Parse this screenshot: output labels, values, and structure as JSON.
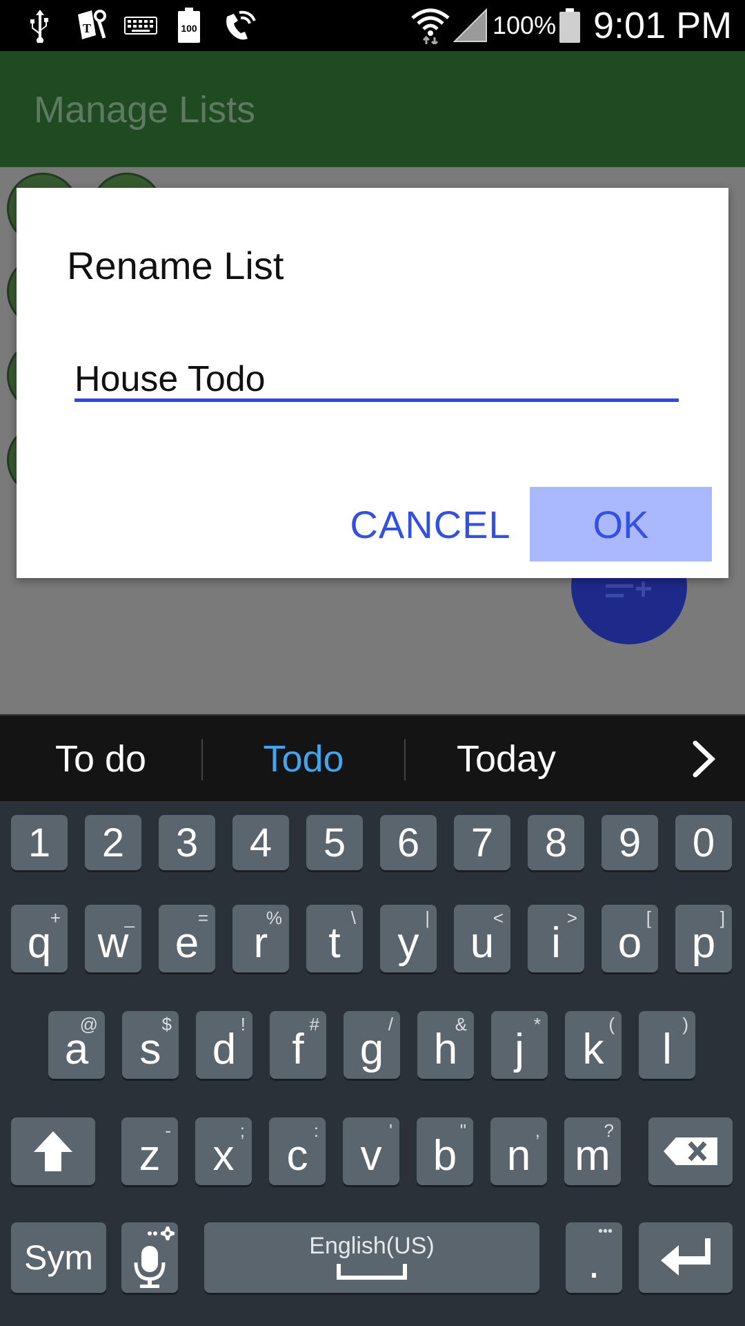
{
  "status_bar": {
    "battery_percent": "100%",
    "time": "9:01 PM",
    "icons": [
      "usb-icon",
      "t-mobile-icon",
      "keyboard-icon",
      "battery-100-icon",
      "wifi-call-icon",
      "wifi-icon",
      "signal-icon",
      "battery-icon"
    ],
    "battery_badge": "100"
  },
  "app": {
    "title": "Manage Lists"
  },
  "dialog": {
    "title": "Rename List",
    "input_value": "House Todo",
    "cancel_label": "CANCEL",
    "ok_label": "OK"
  },
  "keyboard": {
    "suggestions": [
      "To do",
      "Todo",
      "Today"
    ],
    "selected_suggestion": "Todo",
    "row_numbers": [
      "1",
      "2",
      "3",
      "4",
      "5",
      "6",
      "7",
      "8",
      "9",
      "0"
    ],
    "row1": [
      {
        "k": "q",
        "h": "+"
      },
      {
        "k": "w",
        "h": "_"
      },
      {
        "k": "e",
        "h": "="
      },
      {
        "k": "r",
        "h": "%"
      },
      {
        "k": "t",
        "h": "\\"
      },
      {
        "k": "y",
        "h": "|"
      },
      {
        "k": "u",
        "h": "<"
      },
      {
        "k": "i",
        "h": ">"
      },
      {
        "k": "o",
        "h": "["
      },
      {
        "k": "p",
        "h": "]"
      }
    ],
    "row2": [
      {
        "k": "a",
        "h": "@"
      },
      {
        "k": "s",
        "h": "$"
      },
      {
        "k": "d",
        "h": "!"
      },
      {
        "k": "f",
        "h": "#"
      },
      {
        "k": "g",
        "h": "/"
      },
      {
        "k": "h",
        "h": "&"
      },
      {
        "k": "j",
        "h": "*"
      },
      {
        "k": "k",
        "h": "("
      },
      {
        "k": "l",
        "h": ")"
      }
    ],
    "row3": [
      {
        "k": "z",
        "h": "-"
      },
      {
        "k": "x",
        "h": ";"
      },
      {
        "k": "c",
        "h": ":"
      },
      {
        "k": "v",
        "h": "'"
      },
      {
        "k": "b",
        "h": "\""
      },
      {
        "k": "n",
        "h": ","
      },
      {
        "k": "m",
        "h": "?"
      }
    ],
    "sym_label": "Sym",
    "space_label": "English(US)",
    "period_label": ".",
    "period_hint": "•••",
    "colors": {
      "key": "#5b656e",
      "keyboard_bg": "#2a3138",
      "accent": "#3ea6f2"
    }
  }
}
